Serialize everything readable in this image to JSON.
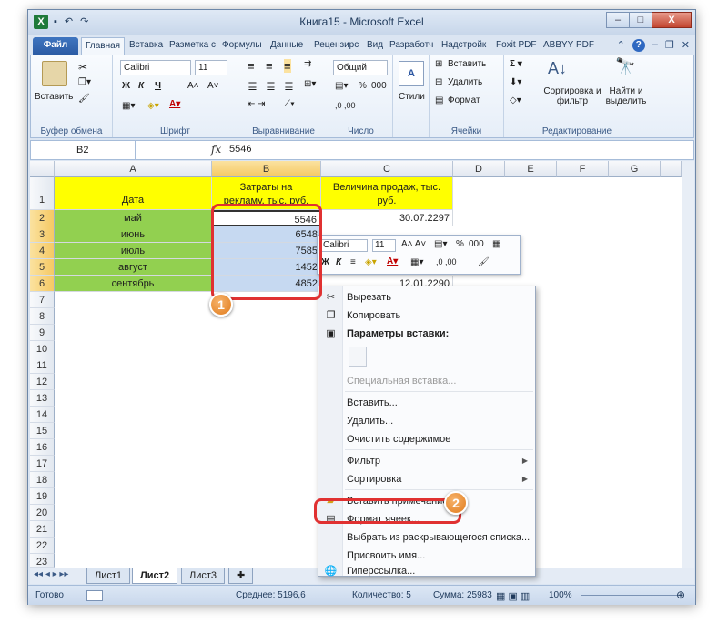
{
  "window": {
    "title": "Книга15 - Microsoft Excel",
    "minimize": "–",
    "maximize": "□",
    "close": "X"
  },
  "qat": {
    "undo": "↶",
    "redo": "↷"
  },
  "tabs": [
    "Файл",
    "Главная",
    "Вставка",
    "Разметка с",
    "Формулы",
    "Данные",
    "Рецензирс",
    "Вид",
    "Разработч",
    "Надстройк",
    "Foxit PDF",
    "ABBYY PDF"
  ],
  "ribbon": {
    "clipboard": {
      "paste": "Вставить",
      "label": "Буфер обмена"
    },
    "font": {
      "name": "Calibri",
      "size": "11",
      "bold": "Ж",
      "italic": "К",
      "underline": "Ч",
      "grow": "A˄",
      "shrink": "A˅",
      "label": "Шрифт"
    },
    "alignment": {
      "label": "Выравнивание"
    },
    "number": {
      "format": "Общий",
      "percent": "%",
      "thousands": "000",
      "inc": ",0 ,00",
      "label": "Число"
    },
    "styles": {
      "label": "Стили"
    },
    "cells": {
      "insert": "Вставить",
      "delete": "Удалить",
      "format": "Формат",
      "label": "Ячейки"
    },
    "editing": {
      "sort": "Сортировка и фильтр",
      "find": "Найти и выделить",
      "label": "Редактирование"
    }
  },
  "formula_bar": {
    "name_box": "B2",
    "fx": "fx",
    "content": "5546"
  },
  "columns": [
    "A",
    "B",
    "C",
    "D",
    "E",
    "F",
    "G"
  ],
  "rows": [
    "1",
    "2",
    "3",
    "4",
    "5",
    "6",
    "7",
    "8",
    "9",
    "10",
    "11",
    "12",
    "13",
    "14",
    "15",
    "16",
    "17",
    "18",
    "19",
    "20",
    "21",
    "22",
    "23"
  ],
  "sheet": {
    "header": {
      "a": "Дата",
      "b1": "Затраты на",
      "b2": "рекламу, тыс. руб.",
      "c1": "Величина продаж, тыс.",
      "c2": "руб."
    },
    "data": [
      {
        "a": "май",
        "b": "5546",
        "c": "30.07.2297"
      },
      {
        "a": "июнь",
        "b": "6548",
        "c": ""
      },
      {
        "a": "июль",
        "b": "7585",
        "c": ""
      },
      {
        "a": "август",
        "b": "1452",
        "c": ""
      },
      {
        "a": "сентябрь",
        "b": "4852",
        "c": "12.01.2290"
      }
    ]
  },
  "mini_toolbar": {
    "font": "Calibri",
    "size": "11",
    "bold": "Ж",
    "italic": "К",
    "percent": "%",
    "thousands": "000"
  },
  "context_menu": {
    "cut": "Вырезать",
    "copy": "Копировать",
    "paste_options": "Параметры вставки:",
    "paste_special": "Специальная вставка...",
    "insert": "Вставить...",
    "delete": "Удалить...",
    "clear": "Очистить содержимое",
    "filter": "Фильтр",
    "sort": "Сортировка",
    "insert_comment": "Вставить примечание",
    "format_cells": "Формат ячеек...",
    "pick_list": "Выбрать из раскрывающегося списка...",
    "define_name": "Присвоить имя...",
    "hyperlink": "Гиперссылка..."
  },
  "sheet_tabs": [
    "Лист1",
    "Лист2",
    "Лист3"
  ],
  "status": {
    "ready": "Готово",
    "average": "Среднее: 5196,6",
    "count": "Количество: 5",
    "sum": "Сумма: 25983",
    "zoom": "100%"
  },
  "callouts": {
    "one": "1",
    "two": "2"
  }
}
